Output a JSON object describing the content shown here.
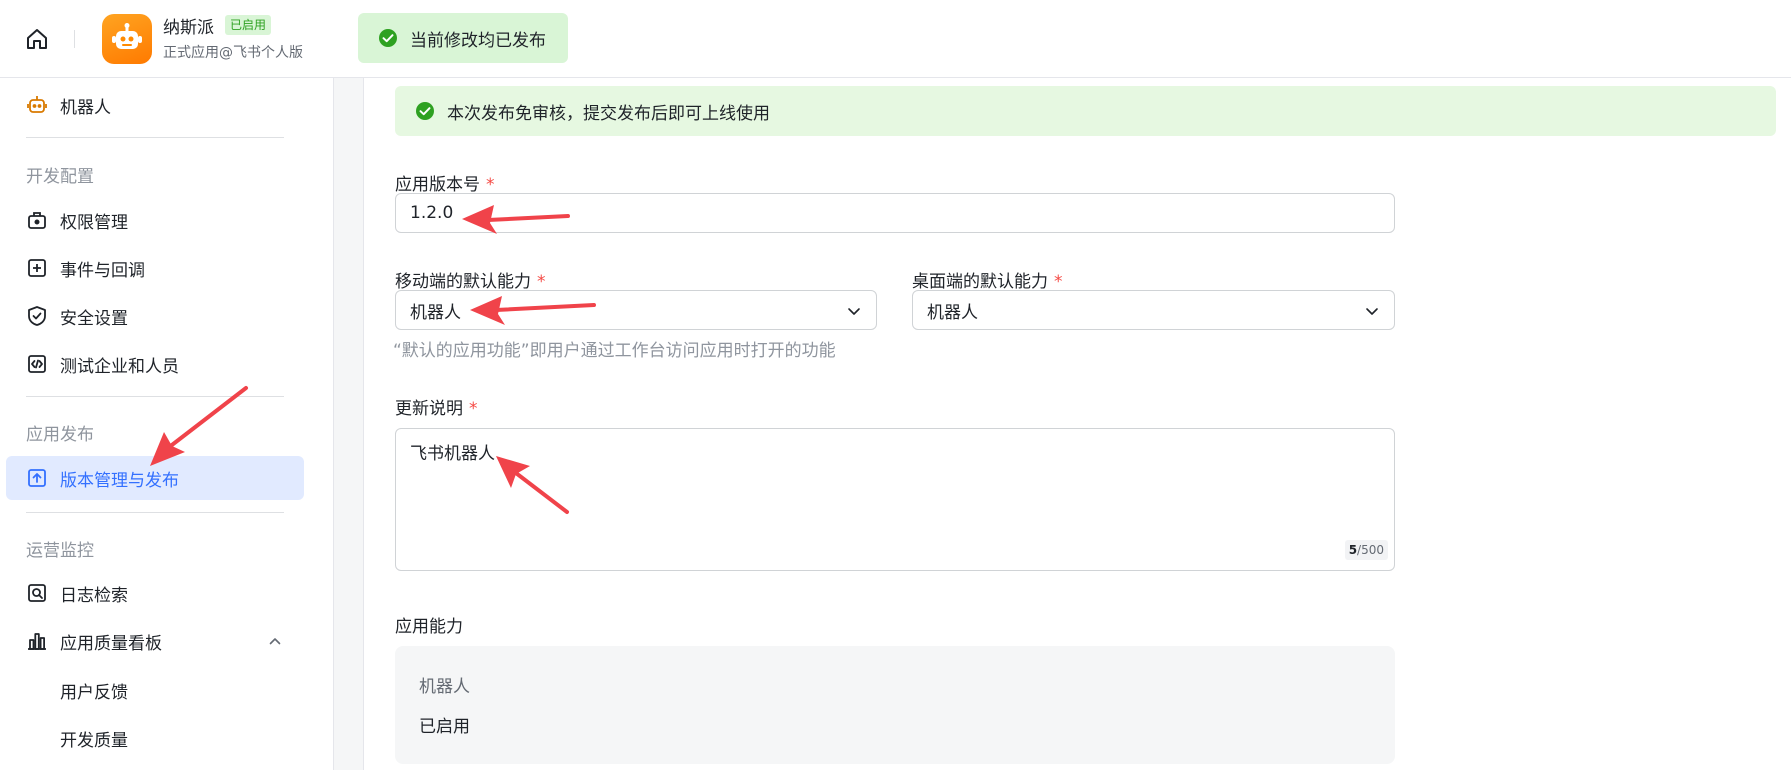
{
  "header": {
    "app_name": "纳斯派",
    "app_badge": "已启用",
    "app_subtitle": "正式应用@飞书个人版",
    "toast": "当前修改均已发布"
  },
  "sidebar": {
    "top_item": "机器人",
    "groups": {
      "dev": "开发配置",
      "publish": "应用发布",
      "ops": "运营监控"
    },
    "items": {
      "permissions": "权限管理",
      "events": "事件与回调",
      "security": "安全设置",
      "test": "测试企业和人员",
      "versions": "版本管理与发布",
      "logs": "日志检索",
      "quality": "应用质量看板",
      "feedback": "用户反馈",
      "dev_quality": "开发质量"
    }
  },
  "main": {
    "notice": "本次发布免审核，提交发布后即可上线使用",
    "version_label": "应用版本号",
    "version_value": "1.2.0",
    "mobile_label": "移动端的默认能力",
    "mobile_value": "机器人",
    "desktop_label": "桌面端的默认能力",
    "desktop_value": "机器人",
    "default_hint": "“默认的应用功能”即用户通过工作台访问应用时打开的功能",
    "notes_label": "更新说明",
    "notes_value": "飞书机器人",
    "notes_count": "5",
    "notes_max": "/500",
    "capability_label": "应用能力",
    "capability_name": "机器人",
    "capability_status": "已启用",
    "required_mark": "*"
  },
  "colors": {
    "accent": "#3370ff",
    "success": "#2ea121",
    "required": "#f54a45",
    "annotation_arrow": "#f0434a"
  }
}
